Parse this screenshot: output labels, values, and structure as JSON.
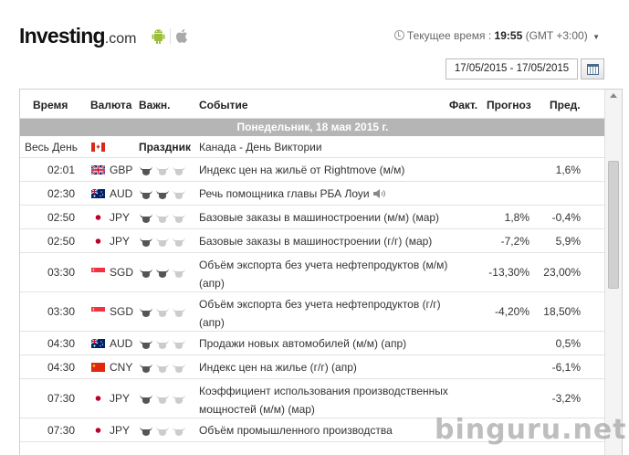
{
  "header": {
    "brand": "Investing",
    "domain": ".com",
    "clock_label": "Текущее время :",
    "clock_time": "19:55",
    "clock_tz": "(GMT +3:00)",
    "date_range": "17/05/2015 - 17/05/2015"
  },
  "table": {
    "columns": {
      "time": "Время",
      "currency": "Валюта",
      "importance": "Важн.",
      "event": "Событие",
      "actual": "Факт.",
      "forecast": "Прогноз",
      "previous": "Пред."
    },
    "day_label": "Понедельник, 18 мая 2015 г.",
    "holiday": {
      "time": "Весь День",
      "flag": "ca",
      "currency_text": "Праздник",
      "event": "Канада - День Виктории"
    },
    "rows": [
      {
        "time": "02:01",
        "flag": "gb",
        "currency": "GBP",
        "bulls": 1,
        "event": "Индекс цен на жильё от Rightmove (м/м)",
        "actual": "",
        "forecast": "",
        "previous": "1,6%",
        "speech": false
      },
      {
        "time": "02:30",
        "flag": "au",
        "currency": "AUD",
        "bulls": 2,
        "event": "Речь помощника главы РБА Лоуи",
        "actual": "",
        "forecast": "",
        "previous": "",
        "speech": true
      },
      {
        "time": "02:50",
        "flag": "jp",
        "currency": "JPY",
        "bulls": 1,
        "event": "Базовые заказы в машиностроении (м/м) (мар)",
        "actual": "",
        "forecast": "1,8%",
        "previous": "-0,4%",
        "speech": false
      },
      {
        "time": "02:50",
        "flag": "jp",
        "currency": "JPY",
        "bulls": 1,
        "event": "Базовые заказы в машиностроении (г/г) (мар)",
        "actual": "",
        "forecast": "-7,2%",
        "previous": "5,9%",
        "speech": false
      },
      {
        "time": "03:30",
        "flag": "sg",
        "currency": "SGD",
        "bulls": 2,
        "event": "Объём экспорта без учета нефтепродуктов (м/м) (апр)",
        "actual": "",
        "forecast": "-13,30%",
        "previous": "23,00%",
        "speech": false
      },
      {
        "time": "03:30",
        "flag": "sg",
        "currency": "SGD",
        "bulls": 1,
        "event": "Объём экспорта без учета нефтепродуктов (г/г) (апр)",
        "actual": "",
        "forecast": "-4,20%",
        "previous": "18,50%",
        "speech": false
      },
      {
        "time": "04:30",
        "flag": "au",
        "currency": "AUD",
        "bulls": 1,
        "event": "Продажи новых автомобилей (м/м) (апр)",
        "actual": "",
        "forecast": "",
        "previous": "0,5%",
        "speech": false
      },
      {
        "time": "04:30",
        "flag": "cn",
        "currency": "CNY",
        "bulls": 1,
        "event": "Индекс цен на жилье (г/г) (апр)",
        "actual": "",
        "forecast": "",
        "previous": "-6,1%",
        "speech": false
      },
      {
        "time": "07:30",
        "flag": "jp",
        "currency": "JPY",
        "bulls": 1,
        "event": "Коэффициент использования производственных мощностей (м/м) (мар)",
        "actual": "",
        "forecast": "",
        "previous": "-3,2%",
        "speech": false
      },
      {
        "time": "07:30",
        "flag": "jp",
        "currency": "JPY",
        "bulls": 1,
        "event": "Объём промышленного производства",
        "actual": "",
        "forecast": "",
        "previous": "",
        "speech": false
      }
    ]
  },
  "watermark": "binguru.net"
}
